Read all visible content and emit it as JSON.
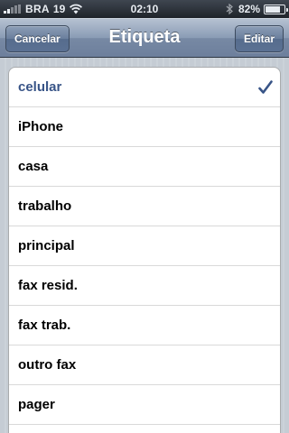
{
  "status_bar": {
    "carrier": "BRA",
    "carrier_code": "19",
    "time": "02:10",
    "battery_percent": "82%",
    "battery_level": 0.82
  },
  "nav_bar": {
    "title": "Etiqueta",
    "left_button": "Cancelar",
    "right_button": "Editar"
  },
  "list": {
    "selected_index": 0,
    "items": [
      {
        "label": "celular"
      },
      {
        "label": "iPhone"
      },
      {
        "label": "casa"
      },
      {
        "label": "trabalho"
      },
      {
        "label": "principal"
      },
      {
        "label": "fax resid."
      },
      {
        "label": "fax trab."
      },
      {
        "label": "outro fax"
      },
      {
        "label": "pager"
      }
    ]
  },
  "colors": {
    "selected_text": "#385487",
    "checkmark": "#385487",
    "nav_bar": "#6d7f9c"
  },
  "icons": [
    "signal-icon",
    "wifi-icon",
    "bluetooth-icon",
    "battery-icon",
    "checkmark-icon"
  ]
}
